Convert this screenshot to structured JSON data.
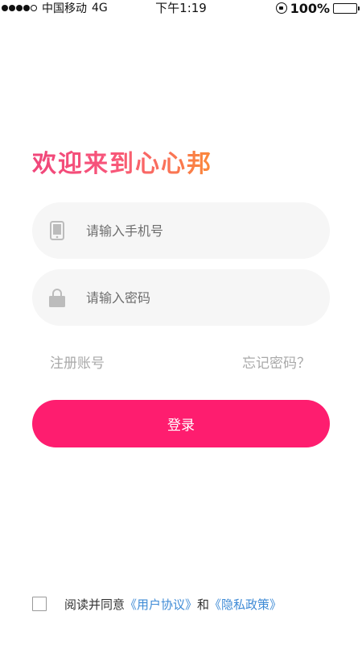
{
  "status_bar": {
    "carrier": "中国移动",
    "network": "4G",
    "time": "下午1:19",
    "battery": "100%",
    "battery_level": 1.0,
    "signal_bars_filled": 4,
    "signal_bars_total": 5
  },
  "welcome_title": "欢迎来到心心邦",
  "phone_field": {
    "placeholder": "请输入手机号",
    "value": "",
    "icon": "phone-icon"
  },
  "password_field": {
    "placeholder": "请输入密码",
    "value": "",
    "icon": "lock-icon"
  },
  "links": {
    "register": "注册账号",
    "forgot": "忘记密码？"
  },
  "login_button": "登录",
  "agreement": {
    "checked": false,
    "prefix": "阅读并同意",
    "user_agreement": "《用户协议》",
    "conjunction": "和",
    "privacy_policy": "《隐私政策》"
  },
  "colors": {
    "accent": "#fe1d6f",
    "title_gradient_start": "#f0467a",
    "title_gradient_end": "#fb8a3a",
    "link": "#3f8bd6",
    "field_bg": "#f6f6f6"
  }
}
